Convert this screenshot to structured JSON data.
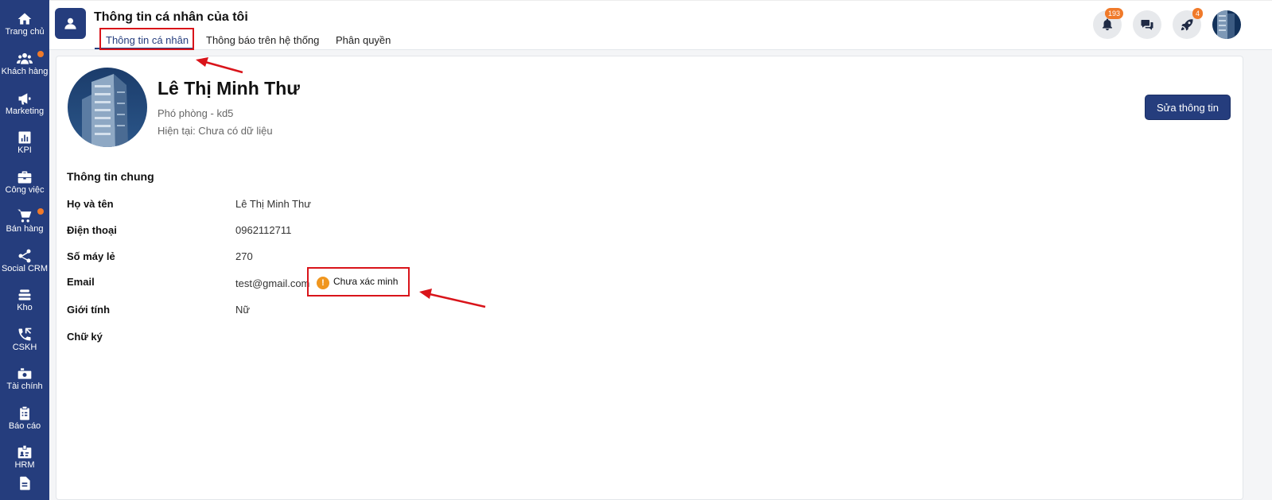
{
  "sidebar": {
    "items": [
      {
        "label": "Trang chủ",
        "icon": "home-icon"
      },
      {
        "label": "Khách hàng",
        "icon": "customers-icon",
        "dot": true
      },
      {
        "label": "Marketing",
        "icon": "megaphone-icon"
      },
      {
        "label": "KPI",
        "icon": "chart-icon"
      },
      {
        "label": "Công việc",
        "icon": "briefcase-icon"
      },
      {
        "label": "Bán hàng",
        "icon": "cart-icon",
        "dot": true
      },
      {
        "label": "Social CRM",
        "icon": "share-icon"
      },
      {
        "label": "Kho",
        "icon": "warehouse-icon"
      },
      {
        "label": "CSKH",
        "icon": "phone-icon"
      },
      {
        "label": "Tài chính",
        "icon": "money-icon"
      },
      {
        "label": "Báo cáo",
        "icon": "clipboard-icon"
      },
      {
        "label": "HRM",
        "icon": "id-badge-icon"
      },
      {
        "label": "",
        "icon": "document-icon"
      }
    ]
  },
  "header": {
    "title": "Thông tin cá nhân của tôi",
    "tabs": [
      {
        "label": "Thông tin cá nhân",
        "active": true
      },
      {
        "label": "Thông báo trên hệ thống",
        "active": false
      },
      {
        "label": "Phân quyền",
        "active": false
      }
    ],
    "notifications_count": "193",
    "rocket_count": "4"
  },
  "profile": {
    "name": "Lê Thị Minh Thư",
    "role": "Phó phòng - kd5",
    "status": "Hiện tại: Chưa có dữ liệu",
    "edit_label": "Sửa thông tin"
  },
  "general": {
    "section_title": "Thông tin chung",
    "fields": [
      {
        "label": "Họ và tên",
        "value": "Lê Thị Minh Thư"
      },
      {
        "label": "Điện thoại",
        "value": "0962112711"
      },
      {
        "label": "Số máy lẻ",
        "value": "270"
      },
      {
        "label": "Email",
        "value": "test@gmail.com"
      },
      {
        "label": "Giới tính",
        "value": "Nữ"
      },
      {
        "label": "Chữ ký",
        "value": ""
      }
    ],
    "email_verify_label": "Chưa xác minh"
  },
  "colors": {
    "brand": "#253d7d",
    "badge": "#f07a2a",
    "annotation": "#d9141a",
    "warning": "#f0961e"
  }
}
